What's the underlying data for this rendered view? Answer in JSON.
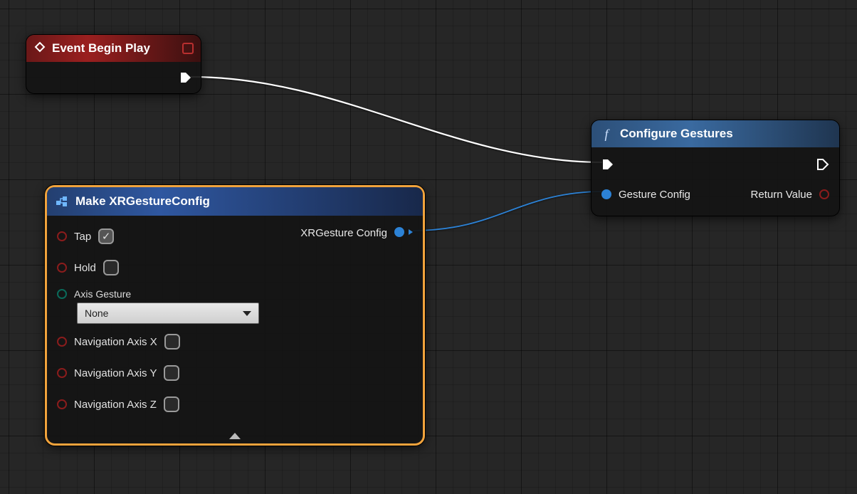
{
  "event_node": {
    "title": "Event Begin Play"
  },
  "func_node": {
    "title": "Configure Gestures",
    "input_label": "Gesture Config",
    "output_label": "Return Value"
  },
  "struct_node": {
    "title": "Make XRGestureConfig",
    "output_label": "XRGesture Config",
    "params": {
      "tap": {
        "label": "Tap",
        "checked": true
      },
      "hold": {
        "label": "Hold",
        "checked": false
      },
      "axis_gesture": {
        "label": "Axis Gesture",
        "value": "None"
      },
      "nav_x": {
        "label": "Navigation Axis X",
        "checked": false
      },
      "nav_y": {
        "label": "Navigation Axis Y",
        "checked": false
      },
      "nav_z": {
        "label": "Navigation Axis Z",
        "checked": false
      }
    }
  }
}
